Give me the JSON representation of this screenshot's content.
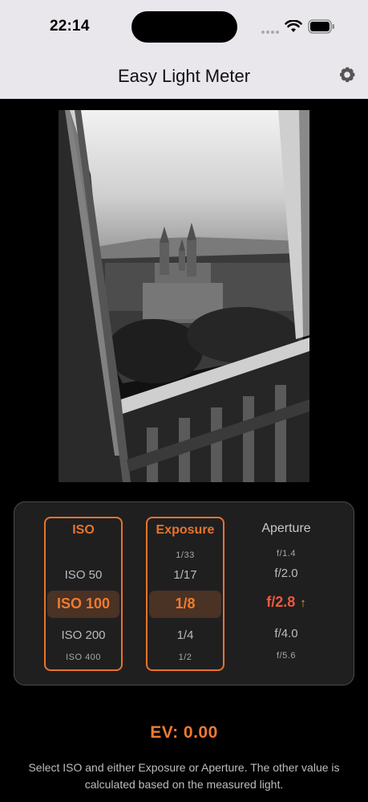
{
  "status_bar": {
    "time": "22:14"
  },
  "nav": {
    "title": "Easy Light Meter",
    "settings_icon": "gear-icon"
  },
  "preview": {
    "description_icon": "camera-preview"
  },
  "iso": {
    "header": "ISO",
    "items": [
      "ISO 50",
      "ISO 100",
      "ISO 200",
      "ISO 400"
    ],
    "selected": "ISO 100"
  },
  "exposure": {
    "header": "Exposure",
    "items": [
      "1/33",
      "1/17",
      "1/8",
      "1/4",
      "1/2"
    ],
    "selected": "1/8"
  },
  "aperture": {
    "header": "Aperture",
    "items": [
      "f/1.4",
      "f/2.0",
      "f/2.8",
      "f/4.0",
      "f/5.6"
    ],
    "selected": "f/2.8",
    "arrow": "↑"
  },
  "ev": {
    "label": "EV: 0.00"
  },
  "help": {
    "text": "Select ISO and either Exposure or Aperture. The other value is calculated based on the measured light."
  },
  "colors": {
    "accent": "#e8742c",
    "computed": "#f05a3c",
    "arrow": "#e8a028"
  }
}
